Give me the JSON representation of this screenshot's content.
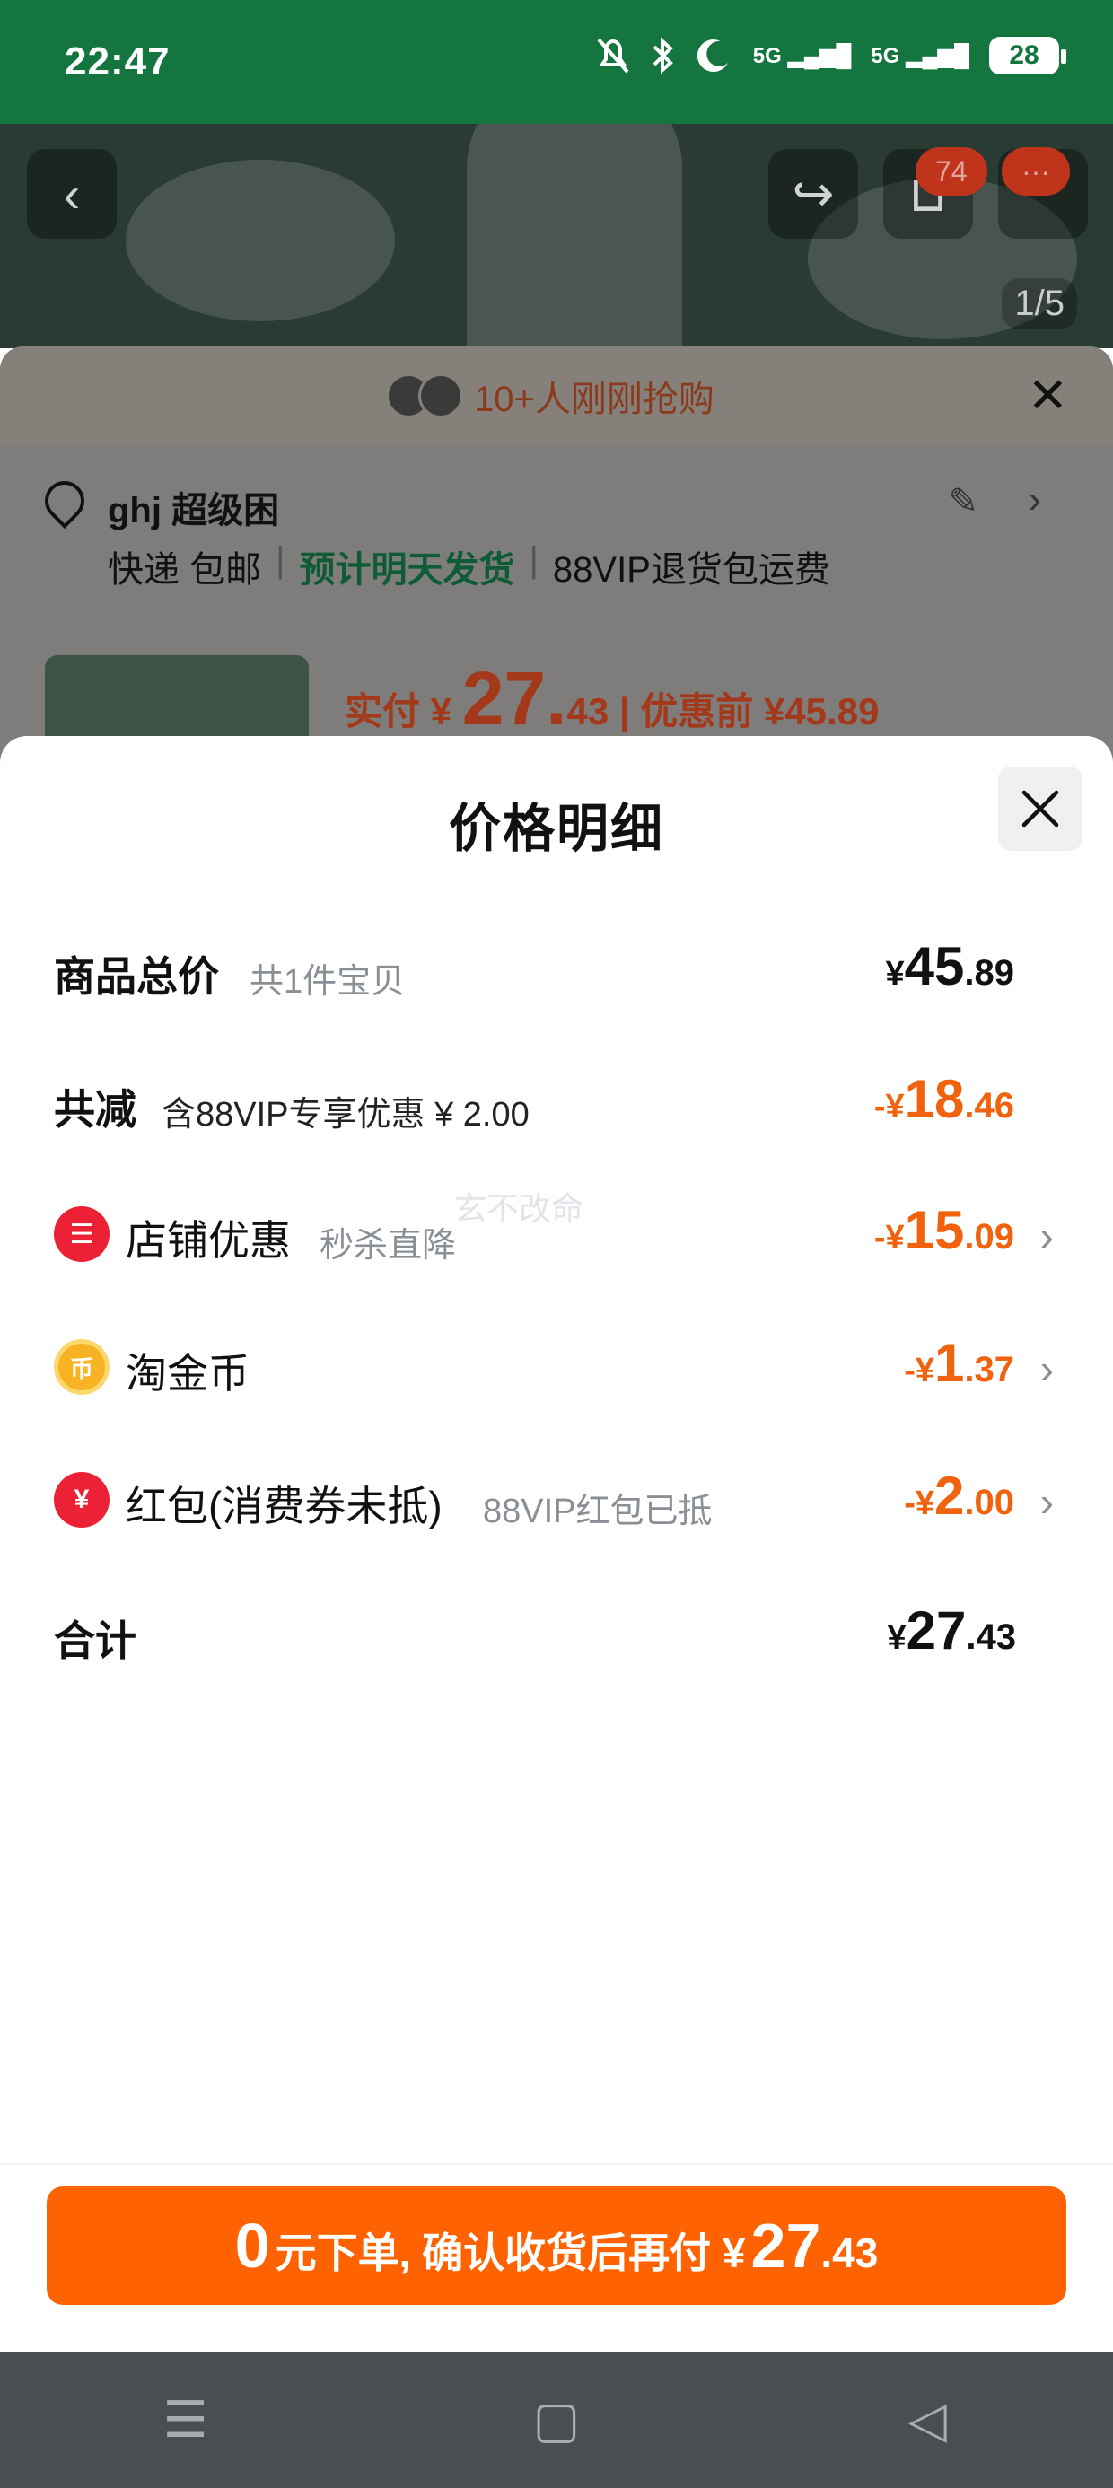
{
  "status_bar": {
    "time": "22:47",
    "signal_1": "5G",
    "signal_2": "5G",
    "battery": "28"
  },
  "background": {
    "cart_badge": "74",
    "more_badge": "···",
    "image_pager": "1/5",
    "buyers_text": "10+人刚刚抢购",
    "address_name": "ghj 超级困",
    "delivery_text": "快递 包邮",
    "ship_text": "预计明天发货",
    "return_text": "88VIP退货包运费",
    "price_prefix": "实付 ¥",
    "price_int": "27.",
    "price_dec": "43",
    "price_before": "优惠前 ¥45.89"
  },
  "sheet": {
    "title": "价格明细",
    "watermark": "玄不改命",
    "rows": {
      "total": {
        "label": "商品总价",
        "note": "共1件宝贝",
        "yen": "¥",
        "int": "45",
        "dec": ".89"
      },
      "reduce": {
        "label": "共减",
        "note": "含88VIP专享优惠 ¥ 2.00",
        "yen": "-¥",
        "int": "18",
        "dec": ".46"
      },
      "shop": {
        "icon_glyph": "☰",
        "label": "店铺优惠",
        "note": "秒杀直降",
        "yen": "-¥",
        "int": "15",
        "dec": ".09"
      },
      "coin": {
        "icon_glyph": "币",
        "label": "淘金币",
        "note": "",
        "yen": "-¥",
        "int": "1",
        "dec": ".37"
      },
      "packet": {
        "icon_glyph": "¥",
        "label": "红包(消费券未抵)",
        "note": "88VIP红包已抵",
        "yen": "-¥",
        "int": "2",
        "dec": ".00"
      },
      "sum": {
        "label": "合计",
        "yen": "¥",
        "int": "27",
        "dec": ".43"
      }
    }
  },
  "pay_button": {
    "zero": "0",
    "text": "元下单, 确认收货后再付 ¥",
    "int": "27",
    "dec": ".43"
  },
  "colors": {
    "accent_orange": "#ff6200",
    "discount_orange": "#f0620d",
    "status_green": "#15753f"
  }
}
